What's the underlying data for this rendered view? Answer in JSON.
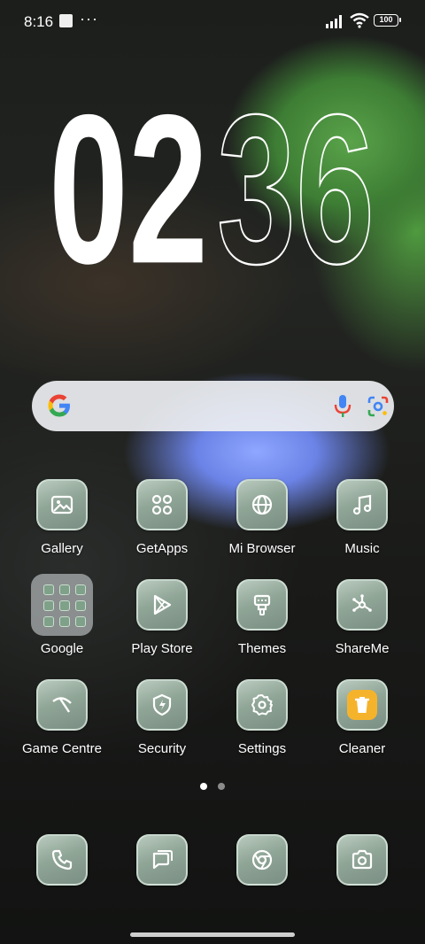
{
  "status_bar": {
    "time": "8:16",
    "more": "···",
    "battery": "100"
  },
  "clock": {
    "hours": "02",
    "minutes": "36"
  },
  "search": {
    "google_letter": "G"
  },
  "apps": [
    {
      "label": "Gallery",
      "icon": "gallery-icon"
    },
    {
      "label": "GetApps",
      "icon": "getapps-icon"
    },
    {
      "label": "Mi Browser",
      "icon": "globe-icon"
    },
    {
      "label": "Music",
      "icon": "music-note-icon"
    },
    {
      "label": "Google",
      "icon": "folder-icon"
    },
    {
      "label": "Play Store",
      "icon": "play-store-icon"
    },
    {
      "label": "Themes",
      "icon": "brush-icon"
    },
    {
      "label": "ShareMe",
      "icon": "share-network-icon"
    },
    {
      "label": "Game Centre",
      "icon": "game-icon"
    },
    {
      "label": "Security",
      "icon": "shield-bolt-icon"
    },
    {
      "label": "Settings",
      "icon": "gear-icon"
    },
    {
      "label": "Cleaner",
      "icon": "trash-icon"
    }
  ],
  "dock": [
    {
      "icon": "phone-icon"
    },
    {
      "icon": "messages-icon"
    },
    {
      "icon": "chrome-icon"
    },
    {
      "icon": "camera-icon"
    }
  ],
  "pager": {
    "pages": 2,
    "current": 1
  }
}
